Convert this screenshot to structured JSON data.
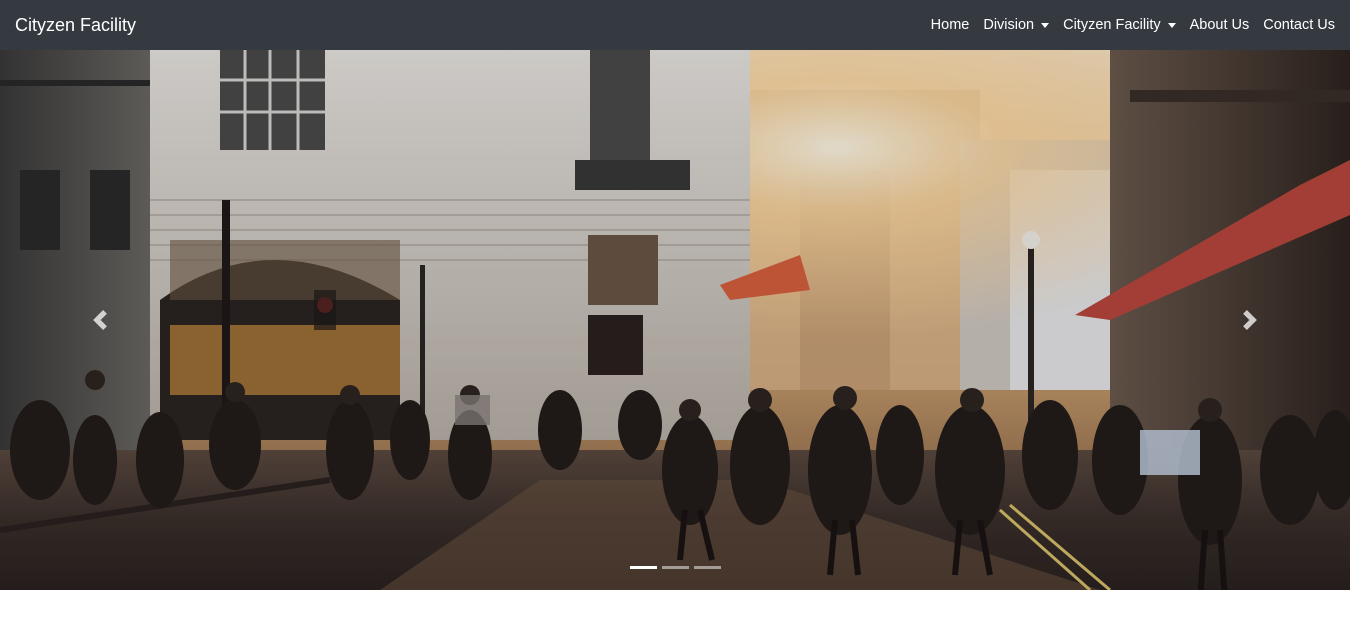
{
  "navbar": {
    "brand": "Cityzen Facility",
    "items": [
      {
        "label": "Home",
        "dropdown": false
      },
      {
        "label": "Division",
        "dropdown": true
      },
      {
        "label": "Cityzen Facility",
        "dropdown": true
      },
      {
        "label": "About Us",
        "dropdown": false
      },
      {
        "label": "Contact Us",
        "dropdown": false
      }
    ],
    "background": "#343a40",
    "text_color": "#ffffff"
  },
  "carousel": {
    "slide_count": 3,
    "active_slide": 1,
    "prev_icon": "chevron-left-icon",
    "next_icon": "chevron-right-icon",
    "image_subject": "busy city street crowd at sunset"
  }
}
